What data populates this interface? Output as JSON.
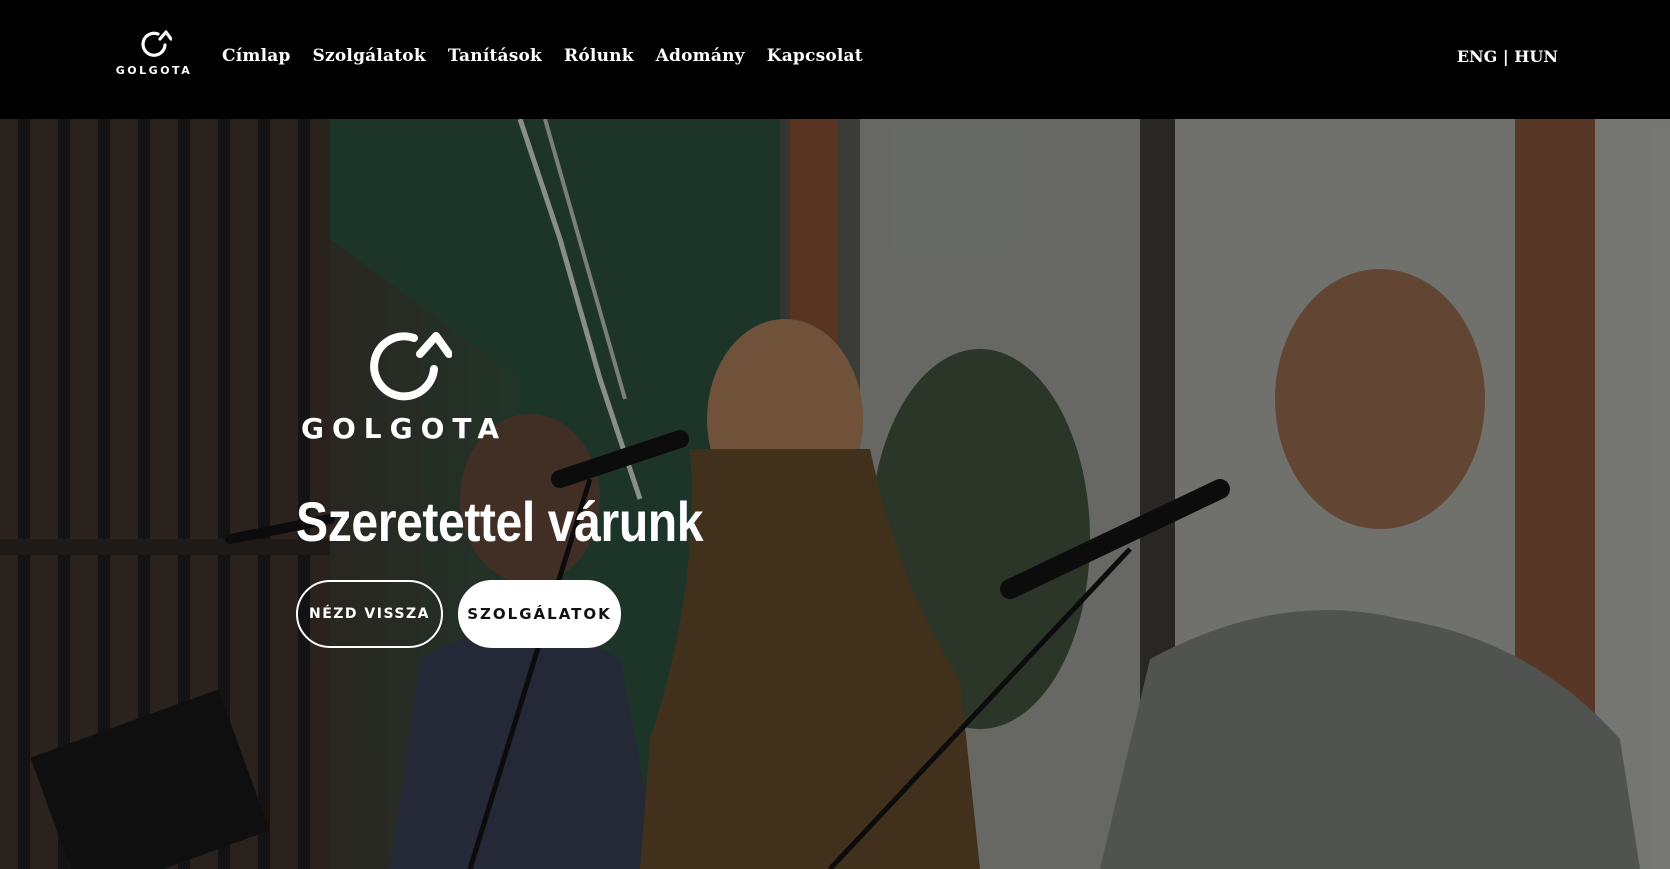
{
  "header": {
    "logo_text": "GOLGOTA",
    "menu": [
      {
        "label": "Címlap"
      },
      {
        "label": "Szolgálatok"
      },
      {
        "label": "Tanítások"
      },
      {
        "label": "Rólunk"
      },
      {
        "label": "Adomány"
      },
      {
        "label": "Kapcsolat"
      }
    ],
    "lang": {
      "eng": "ENG",
      "separator": " | ",
      "hun": "HUN"
    }
  },
  "hero": {
    "logo_text": "GOLGOTA",
    "title": "Szeretettel várunk",
    "buttons": {
      "watch_back": "NÉZD VISSZA",
      "services": "SZOLGÁLATOK"
    }
  },
  "colors": {
    "header_bg": "#000000",
    "text": "#ffffff",
    "button_solid_bg": "#ffffff",
    "button_solid_text": "#111111"
  }
}
